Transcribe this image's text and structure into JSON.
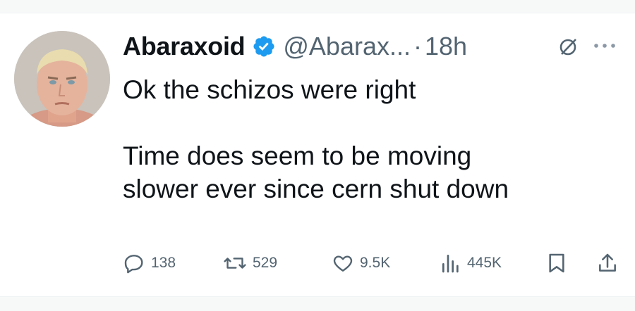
{
  "author": {
    "name": "Abaraxoid",
    "handle": "@Abarax...",
    "separator": "·",
    "time": "18h",
    "verified_color": "#1d9bf0"
  },
  "tweet": {
    "text": "Ok the schizos were right\n\nTime does seem to be moving\nslower ever since cern shut down"
  },
  "actions": {
    "replies": "138",
    "retweets": "529",
    "likes": "9.5K",
    "views": "445K"
  },
  "icons": {
    "grok": "grok-icon",
    "more": "more-icon",
    "reply": "reply-icon",
    "retweet": "retweet-icon",
    "like": "heart-icon",
    "views": "views-icon",
    "bookmark": "bookmark-icon",
    "share": "share-icon"
  },
  "colors": {
    "text": "#0f1419",
    "secondary": "#536471",
    "accent": "#1d9bf0"
  }
}
